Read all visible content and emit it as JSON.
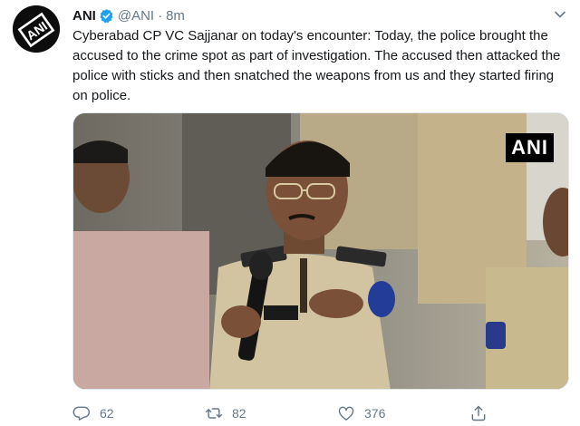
{
  "account": {
    "name": "ANI",
    "handle": "@ANI",
    "separator": "·",
    "time": "8m",
    "avatar_label": "ANI"
  },
  "tweet": {
    "text": "Cyberabad CP VC Sajjanar on today's encounter: Today, the police brought the accused to the crime spot as part of investigation. The accused then attacked the police with sticks and then snatched the weapons from us and they started firing on police."
  },
  "media": {
    "watermark": "ANI"
  },
  "actions": {
    "replies": "62",
    "retweets": "82",
    "likes": "376"
  },
  "icons": {
    "avatar": "ani-logo-icon",
    "verified": "verified-badge-icon",
    "menu": "chevron-down-icon",
    "reply": "reply-icon",
    "retweet": "retweet-icon",
    "like": "heart-icon",
    "share": "share-icon"
  },
  "colors": {
    "text": "#14171a",
    "secondary": "#657786",
    "verified": "#1da1f2",
    "border": "#e1e8ed"
  }
}
